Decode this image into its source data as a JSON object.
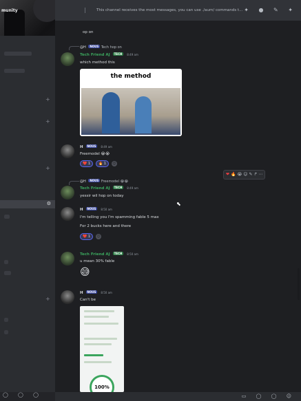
{
  "colors": {
    "background": "#1e1f22",
    "sidebar": "#2b2d31",
    "tech_name": "#3ba55d",
    "accent": "#5865f2"
  },
  "sidebar": {
    "server_name": "munity"
  },
  "topbar": {
    "channel_notice": "This channel receives the most messages, you can use ./aum/ commands t..."
  },
  "messages": [
    {
      "partial_text": "op on"
    },
    {
      "reply_to_user": "@H",
      "reply_tag": "NOUS",
      "reply_text": "Tech hop on",
      "user": "Tech Friend AJ",
      "tag": "TECH",
      "time": "8:49 am",
      "text": "which method this",
      "meme_caption": "the method"
    },
    {
      "user": "H",
      "tag": "NOUS",
      "time": "8:49 am",
      "text": "Freemodel 😭😭",
      "reactions": [
        {
          "emoji": "❤️",
          "count": "1"
        },
        {
          "emoji": "🔥",
          "count": "1"
        }
      ]
    },
    {
      "reply_to_user": "@H",
      "reply_tag": "NOUS",
      "reply_text": "Freemodel 😭😭",
      "user": "Tech Friend AJ",
      "tag": "TECH",
      "time": "8:49 am",
      "text": "yessir wil hop on today"
    },
    {
      "user": "H",
      "tag": "NOUS",
      "time": "8:50 am",
      "text": "I'm telling you I'm spamming fable 5 max",
      "text2": "For 2 bucks here and there",
      "reactions": [
        {
          "emoji": "❤️",
          "count": "1"
        }
      ]
    },
    {
      "user": "Tech Friend AJ",
      "tag": "TECH",
      "time": "8:50 am",
      "text": "u mean 30% fable",
      "emoji": "😅"
    },
    {
      "user": "H",
      "tag": "NOUS",
      "time": "8:50 am",
      "text": "Can't be",
      "shot_title": "100%"
    }
  ],
  "hover_toolbar": [
    "❤",
    "🔥",
    "😭",
    "☺",
    "✎",
    "↱",
    "⋯"
  ]
}
